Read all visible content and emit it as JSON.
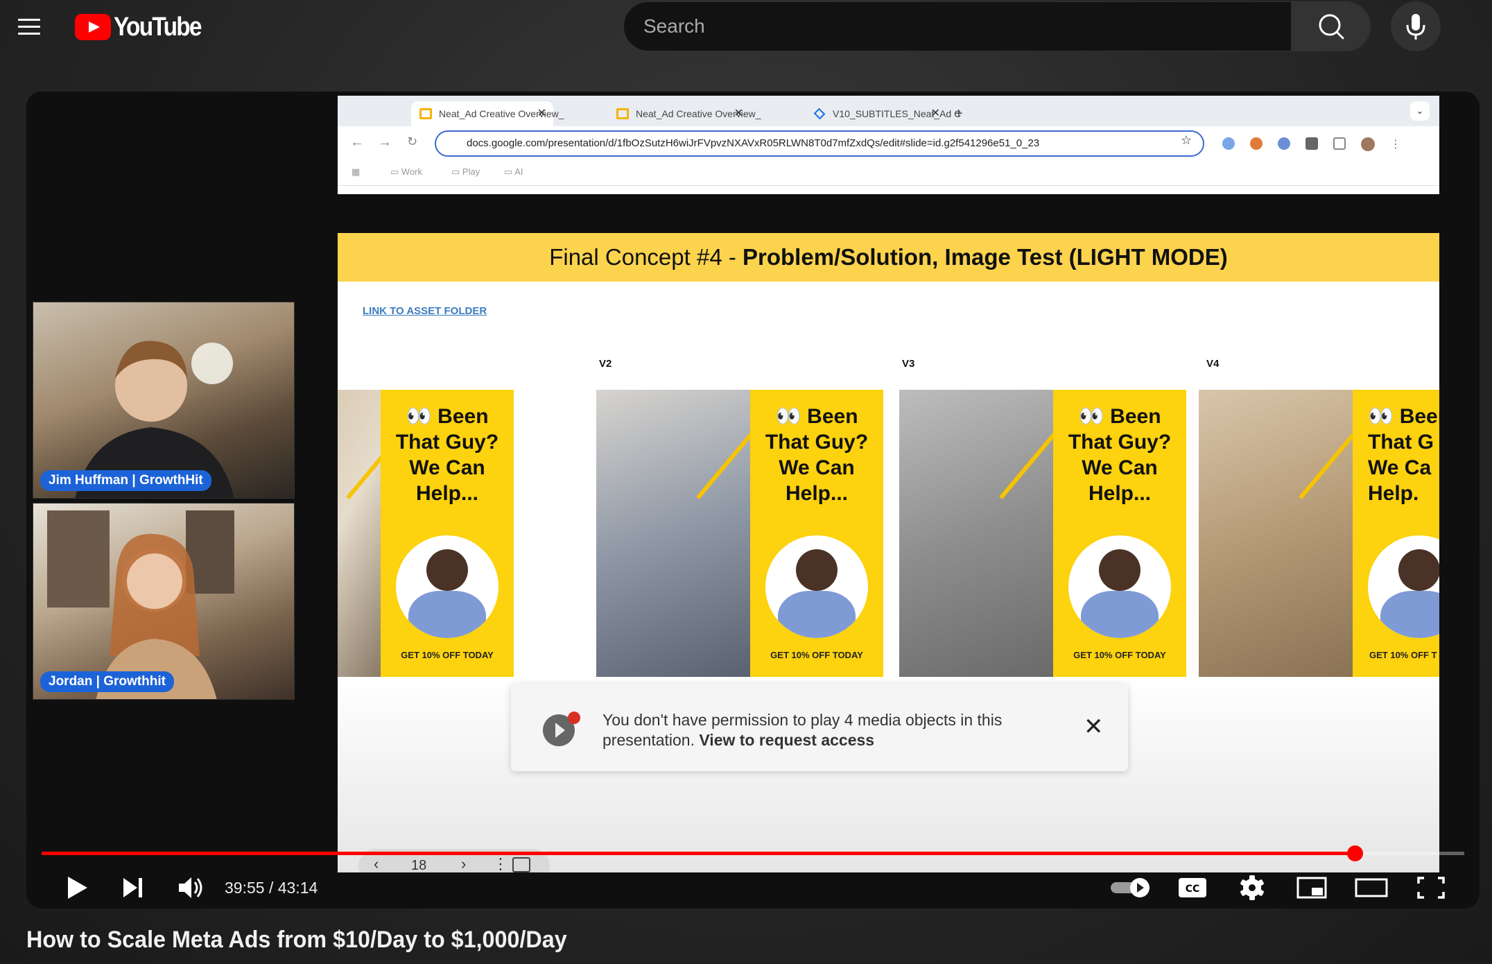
{
  "masthead": {
    "logo_text": "YouTube",
    "search_placeholder": "Search",
    "icons": [
      "menu-icon",
      "search-icon",
      "mic-icon"
    ]
  },
  "video": {
    "title": "How to Scale Meta Ads from $10/Day to $1,000/Day",
    "current_time": "39:55",
    "duration": "43:14",
    "time_display": "39:55 / 43:14",
    "progress_fraction": 0.923
  },
  "webcams": [
    {
      "name": "Jim Huffman | GrowthHit"
    },
    {
      "name": "Jordan | Growthhit"
    }
  ],
  "browser": {
    "tabs": [
      {
        "label": "Neat_Ad Creative Overview_",
        "active": true
      },
      {
        "label": "Neat_Ad Creative Overview_",
        "active": false
      },
      {
        "label": "V10_SUBTITLES_Neat_Ad C",
        "active": false
      }
    ],
    "new_tab": "+",
    "url": "docs.google.com/presentation/d/1fbOzSutzH6wiJrFVpvzNXAVxR05RLWN8T0d7mfZxdQs/edit#slide=id.g2f541296e51_0_23",
    "bookmarks": [
      "Work",
      "Play",
      "AI"
    ]
  },
  "slide": {
    "title_prefix": "Final Concept #4 - ",
    "title_bold": "Problem/Solution, Image Test (LIGHT MODE)",
    "asset_link": "LINK TO ASSET FOLDER",
    "version_labels": [
      "V2",
      "V3",
      "V4"
    ],
    "ad_copy_lines": [
      "Been",
      "That Guy?",
      "We Can",
      "Help..."
    ],
    "ad_cta": "GET 10% OFF TODAY",
    "ad_v4_copy_lines": [
      "Beer",
      "That G",
      "We Ca",
      "Help."
    ],
    "ad_v4_cta": "GET 10% OFF T",
    "permission_text": "You don't have permission to play 4 media objects in this presentation. ",
    "permission_link": "View to request access",
    "page_number": "18"
  },
  "colors": {
    "accent_red": "#ff0000",
    "slide_yellow": "#fcd34d",
    "ad_yellow": "#fdd20e",
    "webcam_label_blue": "#1d63d8"
  }
}
